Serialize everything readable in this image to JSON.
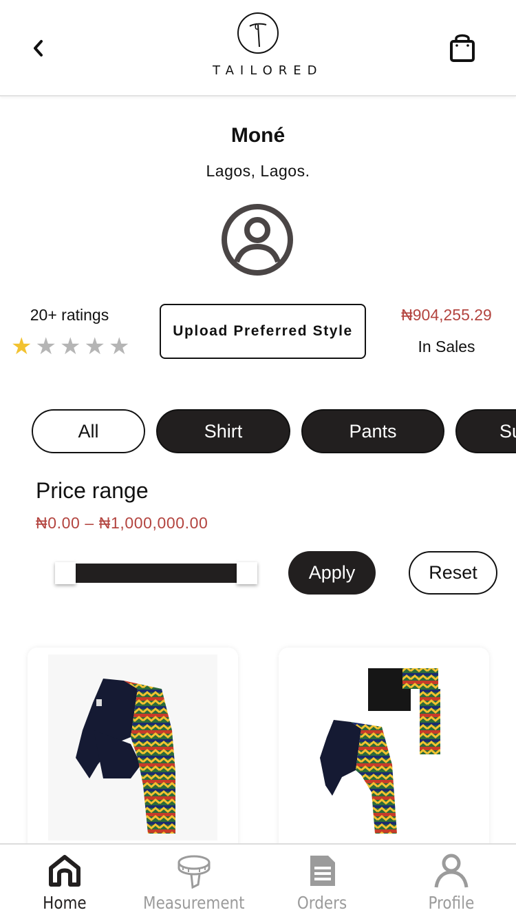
{
  "header": {
    "brand": "TAILORED",
    "back_icon": "chevron-left-icon",
    "bag_icon": "shopping-bag-icon"
  },
  "store": {
    "name": "Moné",
    "location": "Lagos, Lagos.",
    "avatar_icon": "user-circle-icon",
    "ratings_label": "20+ ratings",
    "rating": 1,
    "rating_max": 5,
    "upload_button": "Upload Preferred Style",
    "sales_amount": "₦904,255.29",
    "sales_label": "In Sales"
  },
  "categories": [
    {
      "label": "All",
      "selected": false
    },
    {
      "label": "Shirt",
      "selected": true
    },
    {
      "label": "Pants",
      "selected": true
    },
    {
      "label": "Su",
      "selected": true
    }
  ],
  "price_filter": {
    "title": "Price range",
    "range_text": "₦0.00 – ₦1,000,000.00",
    "min_fraction": 0,
    "max_fraction": 1,
    "apply_label": "Apply",
    "reset_label": "Reset"
  },
  "tabs": [
    {
      "label": "Home",
      "icon": "home-icon",
      "active": true
    },
    {
      "label": "Measurement",
      "icon": "measuring-tape-icon",
      "active": false
    },
    {
      "label": "Orders",
      "icon": "document-icon",
      "active": false
    },
    {
      "label": "Profile",
      "icon": "person-icon",
      "active": false
    }
  ],
  "colors": {
    "accent_price": "#b3443f",
    "dark": "#221f1f",
    "star_filled": "#f2c230",
    "star_empty": "#b5b5b5",
    "inactive_tab": "#9b9b9b"
  }
}
